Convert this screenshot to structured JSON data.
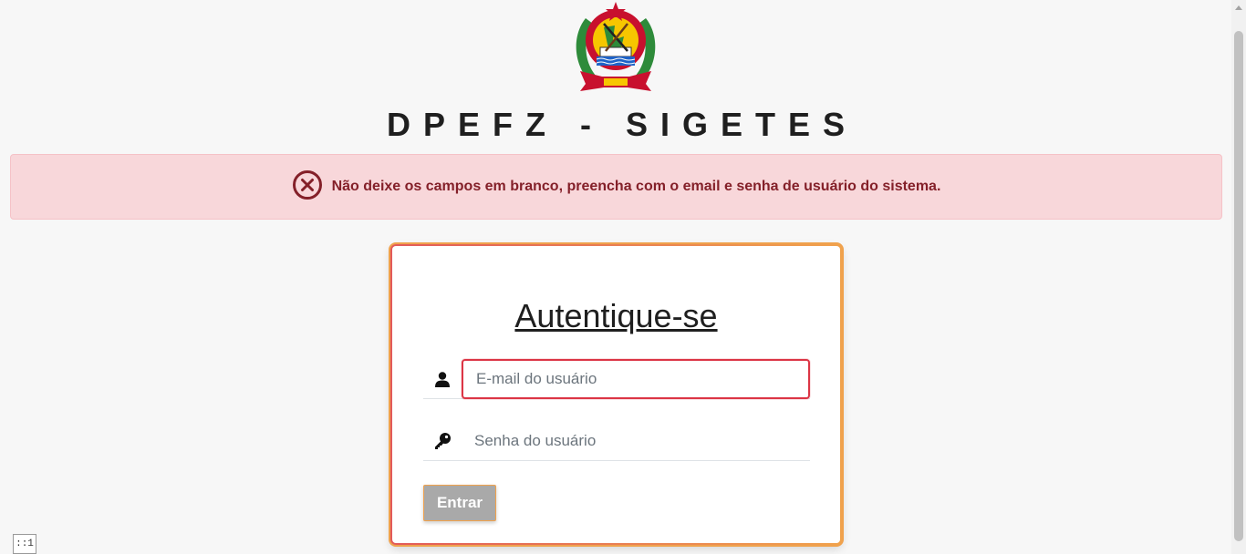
{
  "header": {
    "emblem_icon": "mozambique-coat-of-arms",
    "system_title": "DPEFZ - SIGETES"
  },
  "alert": {
    "icon": "x-circle-icon",
    "message": "Não deixe os campos em branco, preencha com o email e senha de usuário do sistema.",
    "color": "#842029",
    "background": "#f8d7da"
  },
  "login": {
    "title": "Autentique-se",
    "email": {
      "icon": "user-icon",
      "value": "",
      "placeholder": "E-mail do usuário"
    },
    "password": {
      "icon": "key-icon",
      "value": "",
      "placeholder": "Senha do usuário"
    },
    "submit_label": "Entrar"
  },
  "debug_badge": "::1",
  "colors": {
    "error_border": "#dc3545",
    "card_border_start": "#e25a5a",
    "card_border_end": "#f0a24d",
    "button_bg": "#a9a9a9"
  }
}
